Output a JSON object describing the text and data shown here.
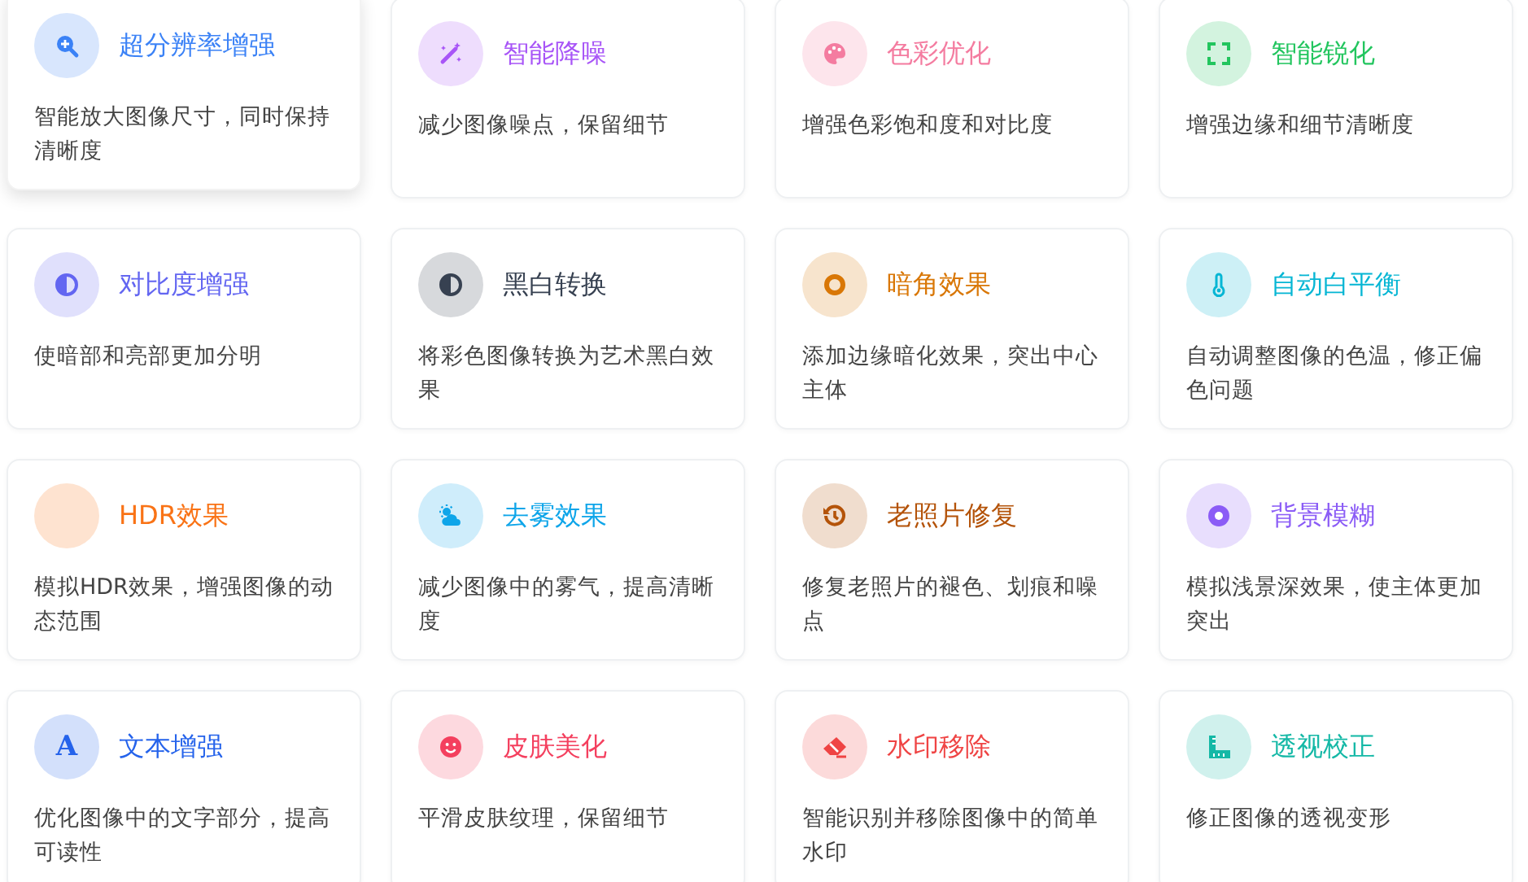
{
  "cards": [
    {
      "title": "超分辨率增强",
      "description": "智能放大图像尺寸，同时保持清晰度",
      "kind": "zoom",
      "color": "#3b82f6",
      "highlighted": true
    },
    {
      "title": "智能降噪",
      "description": "减少图像噪点，保留细节",
      "kind": "wand",
      "color": "#a855f7",
      "highlighted": false
    },
    {
      "title": "色彩优化",
      "description": "增强色彩饱和度和对比度",
      "kind": "palette",
      "color": "#f47ca0",
      "highlighted": false
    },
    {
      "title": "智能锐化",
      "description": "增强边缘和细节清晰度",
      "kind": "expand",
      "color": "#22c55e",
      "highlighted": false
    },
    {
      "title": "对比度增强",
      "description": "使暗部和亮部更加分明",
      "kind": "contrast",
      "color": "#6366f1",
      "highlighted": false
    },
    {
      "title": "黑白转换",
      "description": "将彩色图像转换为艺术黑白效果",
      "kind": "contrast",
      "color": "#374151",
      "highlighted": false
    },
    {
      "title": "暗角效果",
      "description": "添加边缘暗化效果，突出中心主体",
      "kind": "ring",
      "color": "#d97706",
      "highlighted": false
    },
    {
      "title": "自动白平衡",
      "description": "自动调整图像的色温，修正偏色问题",
      "kind": "thermometer",
      "color": "#06b6d4",
      "highlighted": false
    },
    {
      "title": "HDR效果",
      "description": "模拟HDR效果，增强图像的动态范围",
      "kind": "blank",
      "color": "#f97316",
      "highlighted": false
    },
    {
      "title": "去雾效果",
      "description": "减少图像中的雾气，提高清晰度",
      "kind": "weather",
      "color": "#0ea5e9",
      "highlighted": false
    },
    {
      "title": "老照片修复",
      "description": "修复老照片的褪色、划痕和噪点",
      "kind": "history",
      "color": "#b45309",
      "highlighted": false
    },
    {
      "title": "背景模糊",
      "description": "模拟浅景深效果，使主体更加突出",
      "kind": "dot",
      "color": "#8b5cf6",
      "highlighted": false
    },
    {
      "title": "文本增强",
      "description": "优化图像中的文字部分，提高可读性",
      "kind": "glyph",
      "glyph": "A",
      "color": "#2563eb",
      "highlighted": false
    },
    {
      "title": "皮肤美化",
      "description": "平滑皮肤纹理，保留细节",
      "kind": "smile",
      "color": "#f43f5e",
      "highlighted": false
    },
    {
      "title": "水印移除",
      "description": "智能识别并移除图像中的简单水印",
      "kind": "eraser",
      "color": "#ef4444",
      "highlighted": false
    },
    {
      "title": "透视校正",
      "description": "修正图像的透视变形",
      "kind": "ruler",
      "color": "#14b8a6",
      "highlighted": false
    }
  ]
}
